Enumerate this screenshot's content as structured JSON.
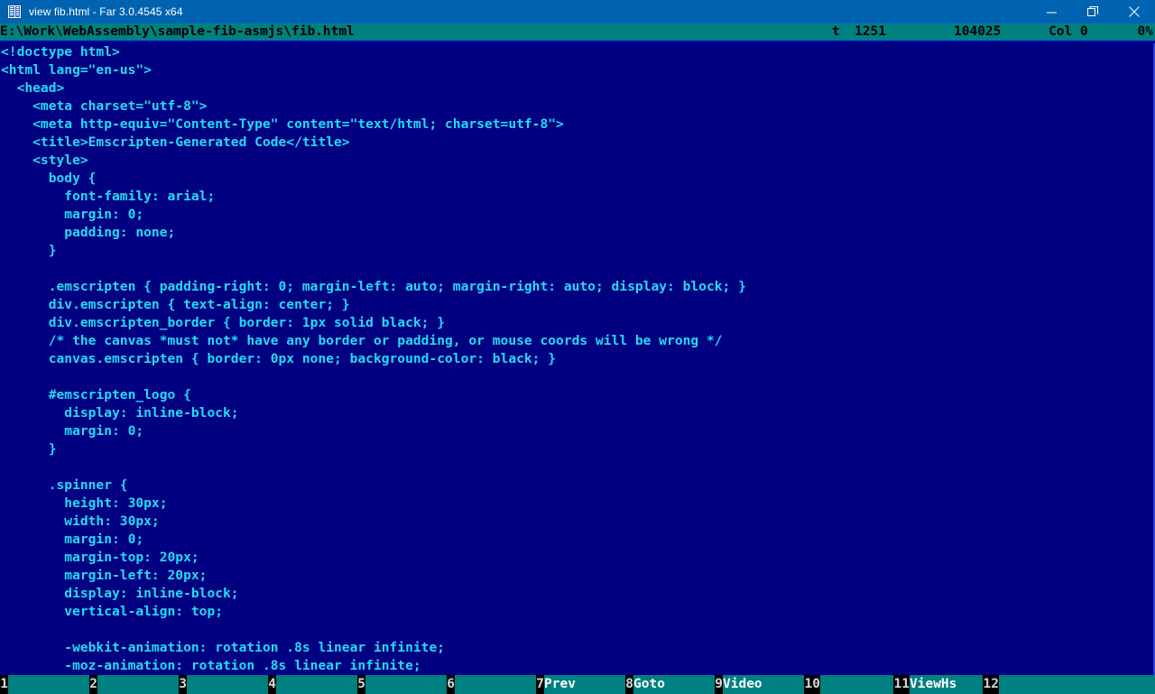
{
  "window": {
    "title": "view fib.html - Far 3.0.4545 x64",
    "icon": "far-manager-icon",
    "controls": [
      {
        "name": "minimize-button",
        "glyph": "minimize-icon"
      },
      {
        "name": "restore-button",
        "glyph": "restore-icon"
      },
      {
        "name": "close-button",
        "glyph": "close-icon"
      }
    ]
  },
  "statusbar": {
    "path": "E:\\Work\\WebAssembly\\sample-fib-asmjs\\fib.html",
    "encoding": "t",
    "line": "1251",
    "offset": "104025",
    "column_label": "Col 0",
    "percent": "0%"
  },
  "viewer": {
    "lines": [
      "<!doctype html>",
      "<html lang=\"en-us\">",
      "  <head>",
      "    <meta charset=\"utf-8\">",
      "    <meta http-equiv=\"Content-Type\" content=\"text/html; charset=utf-8\">",
      "    <title>Emscripten-Generated Code</title>",
      "    <style>",
      "      body {",
      "        font-family: arial;",
      "        margin: 0;",
      "        padding: none;",
      "      }",
      "",
      "      .emscripten { padding-right: 0; margin-left: auto; margin-right: auto; display: block; }",
      "      div.emscripten { text-align: center; }",
      "      div.emscripten_border { border: 1px solid black; }",
      "      /* the canvas *must not* have any border or padding, or mouse coords will be wrong */",
      "      canvas.emscripten { border: 0px none; background-color: black; }",
      "",
      "      #emscripten_logo {",
      "        display: inline-block;",
      "        margin: 0;",
      "      }",
      "",
      "      .spinner {",
      "        height: 30px;",
      "        width: 30px;",
      "        margin: 0;",
      "        margin-top: 20px;",
      "        margin-left: 20px;",
      "        display: inline-block;",
      "        vertical-align: top;",
      "",
      "        -webkit-animation: rotation .8s linear infinite;",
      "        -moz-animation: rotation .8s linear infinite;"
    ]
  },
  "function_keys": [
    {
      "num": "1",
      "label": ""
    },
    {
      "num": "2",
      "label": ""
    },
    {
      "num": "3",
      "label": ""
    },
    {
      "num": "4",
      "label": ""
    },
    {
      "num": "5",
      "label": ""
    },
    {
      "num": "6",
      "label": ""
    },
    {
      "num": "7",
      "label": "Prev"
    },
    {
      "num": "8",
      "label": "Goto"
    },
    {
      "num": "9",
      "label": "Video"
    },
    {
      "num": "10",
      "label": ""
    },
    {
      "num": "11",
      "label": "ViewHs"
    },
    {
      "num": "12",
      "label": ""
    }
  ],
  "colors": {
    "titlebar": "#0063b1",
    "statusbar": "#008080",
    "viewer_bg": "#000080",
    "viewer_text": "#23dbf5",
    "fkey_num_bg": "#000000"
  }
}
